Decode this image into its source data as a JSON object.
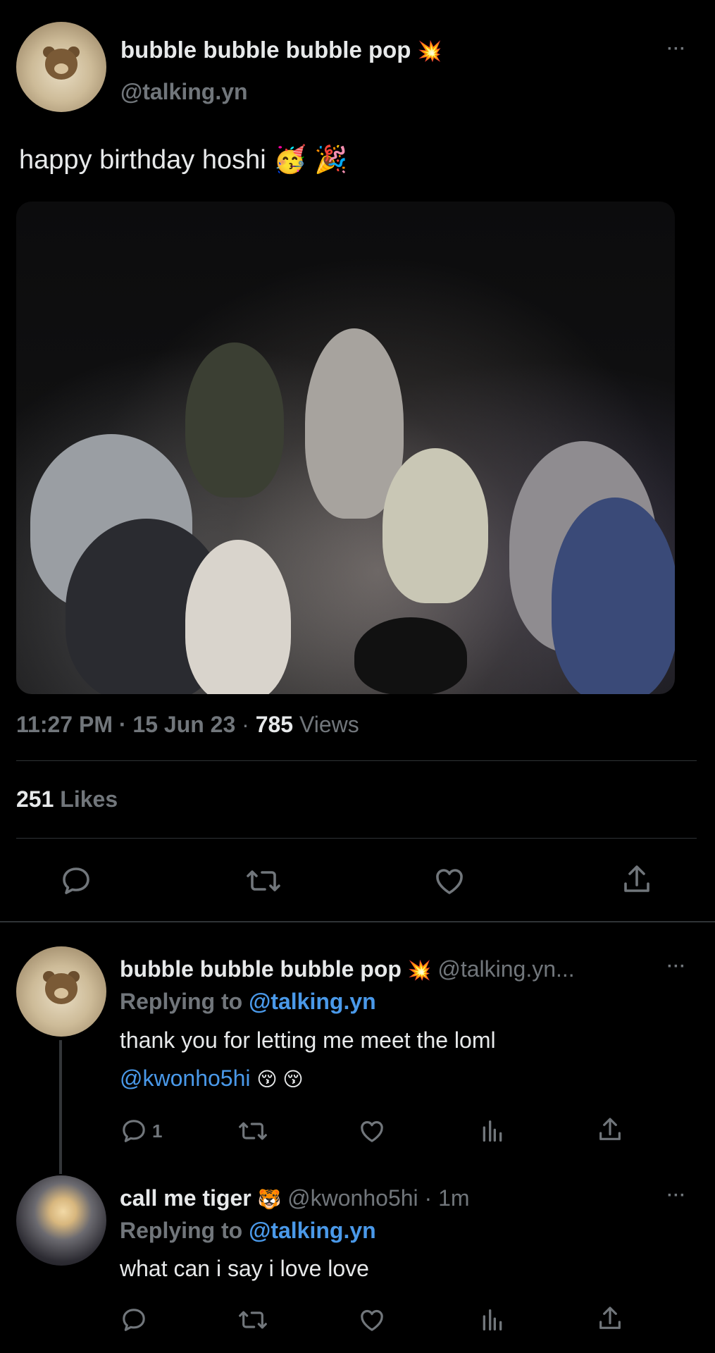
{
  "tweet": {
    "display_name": "bubble bubble bubble pop",
    "name_emoji": "💥",
    "handle": "@talking.yn",
    "text": "happy birthday hoshi 🥳 🎉",
    "time": "11:27 PM",
    "sep1": "·",
    "date": "15 Jun 23",
    "sep2": "·",
    "views_count": "785",
    "views_label": "Views",
    "likes_count": "251",
    "likes_label": "Likes",
    "more": "···"
  },
  "reply1": {
    "display_name": "bubble bubble bubble pop",
    "name_emoji": "💥",
    "handle": "@talking.yn...",
    "replying_label": "Replying to",
    "replying_handle": "@talking.yn",
    "text_line1": "thank you for letting me meet the loml",
    "mention": "@kwonho5hi",
    "emojis": "😚 😚",
    "reply_count": "1",
    "more": "···"
  },
  "reply2": {
    "display_name": "call me tiger",
    "name_emoji": "🐯",
    "handle": "@kwonho5hi",
    "sep": "·",
    "age": "1m",
    "replying_label": "Replying to",
    "replying_handle": "@talking.yn",
    "text": "what can i say i love love",
    "more": "···"
  },
  "colors": {
    "background": "#000000",
    "text": "#e7e9ea",
    "muted": "#71767b",
    "link": "#4a99e9",
    "divider": "#2f3336"
  },
  "icons": [
    "reply-icon",
    "retweet-icon",
    "like-icon",
    "share-icon",
    "analytics-icon",
    "more-icon"
  ]
}
